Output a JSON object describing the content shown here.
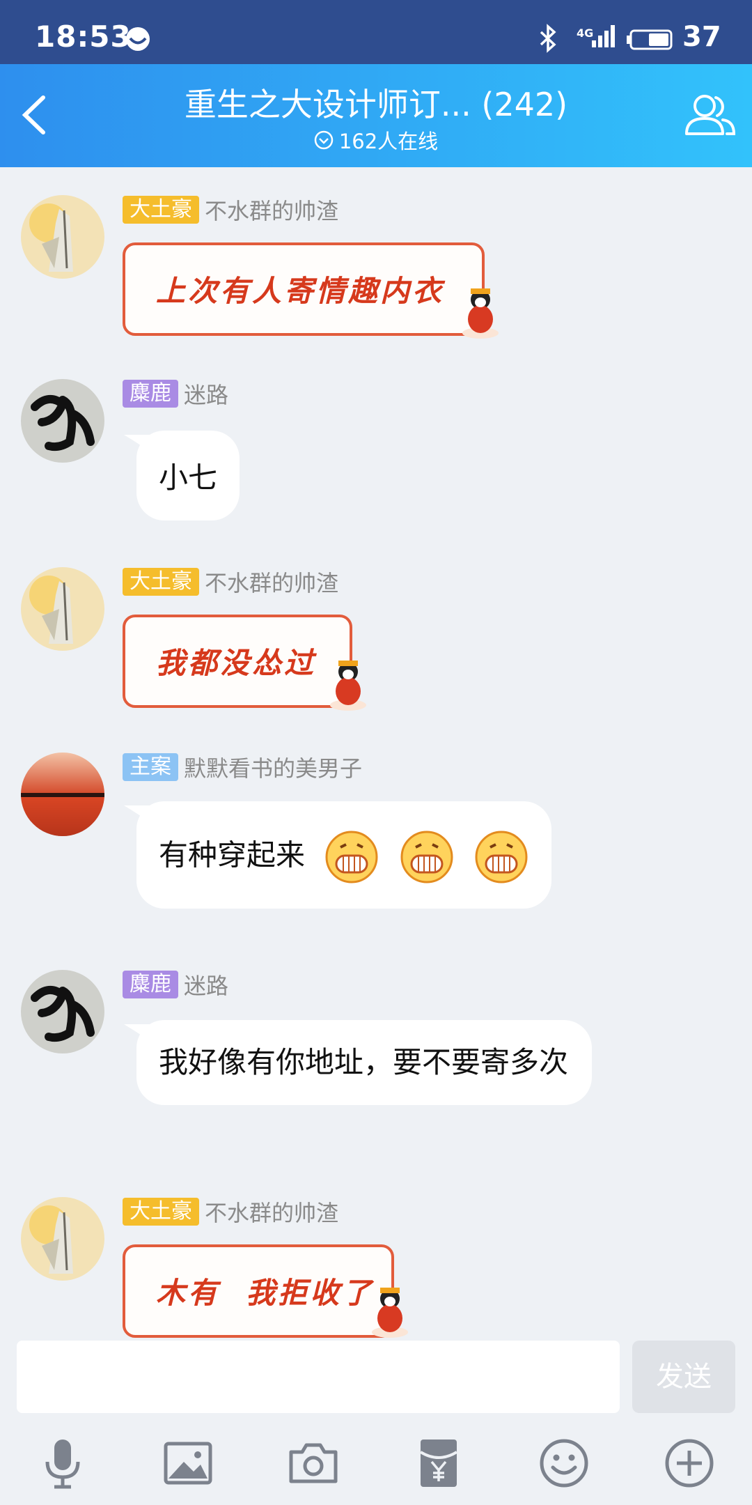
{
  "status_bar": {
    "time": "18:53",
    "network": "4G",
    "battery": "37"
  },
  "header": {
    "title": "重生之大设计师订... (242)",
    "online": "162人在线"
  },
  "messages": [
    {
      "badge": "大土豪",
      "badge_color": "#f5bd2c",
      "nick": "不水群的帅渣",
      "text": "上次有人寄情趣内衣",
      "style": "fancy"
    },
    {
      "badge": "麋鹿",
      "badge_color": "#a98be4",
      "nick": "迷路",
      "text": "小七",
      "style": "plain"
    },
    {
      "badge": "大土豪",
      "badge_color": "#f5bd2c",
      "nick": "不水群的帅渣",
      "text": "我都没怂过",
      "style": "fancy"
    },
    {
      "badge": "主案",
      "badge_color": "#8cc3f4",
      "nick": "默默看书的美男子",
      "text": "有种穿起来",
      "style": "plain",
      "emoji": [
        "grin-emoji",
        "grin-emoji",
        "grin-emoji"
      ]
    },
    {
      "badge": "麋鹿",
      "badge_color": "#a98be4",
      "nick": "迷路",
      "text": "我好像有你地址，要不要寄多次",
      "style": "plain"
    },
    {
      "badge": "大土豪",
      "badge_color": "#f5bd2c",
      "nick": "不水群的帅渣",
      "text": "木有  我拒收了",
      "style": "fancy"
    }
  ],
  "input": {
    "placeholder": "",
    "send_label": "发送"
  },
  "toolbar": [
    "mic-icon",
    "image-icon",
    "camera-icon",
    "red-packet-icon",
    "emoji-icon",
    "plus-icon"
  ]
}
